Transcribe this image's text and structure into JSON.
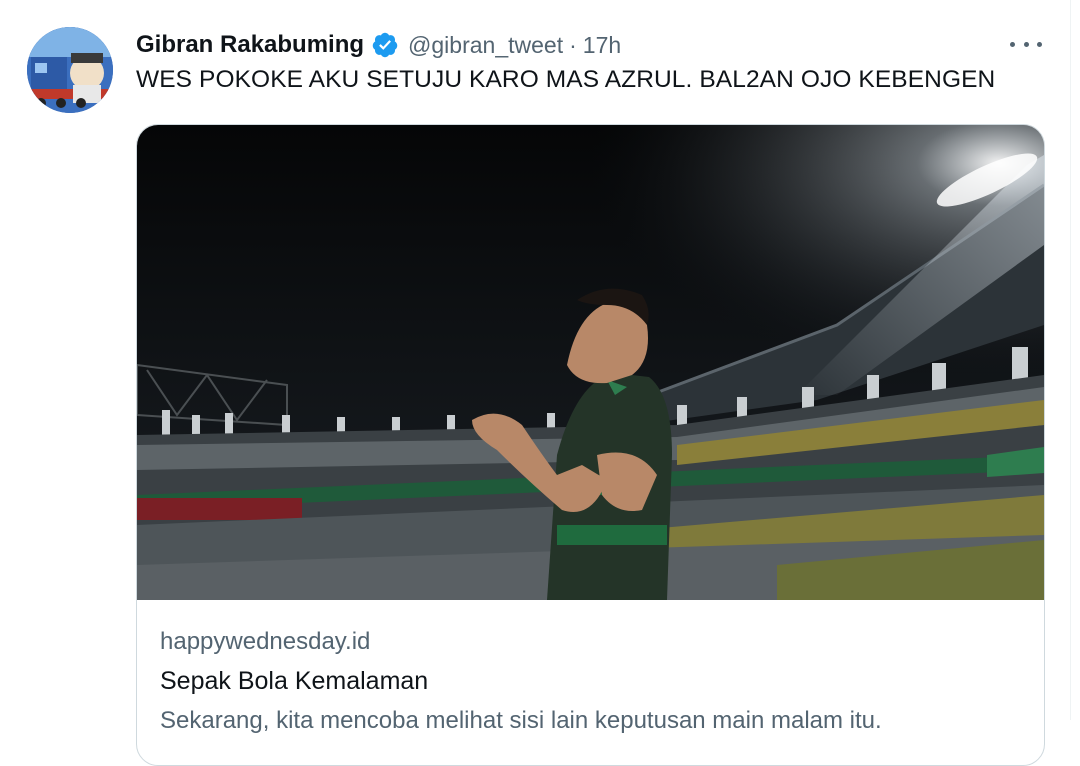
{
  "tweet": {
    "author_name": "Gibran Rakabuming",
    "handle": "@gibran_tweet",
    "separator": "·",
    "time": "17h",
    "text": "WES POKOKE AKU SETUJU KARO MAS AZRUL. BAL2AN OJO KEBENGEN"
  },
  "card": {
    "domain": "happywednesday.id",
    "title": "Sepak Bola Kemalaman",
    "description": "Sekarang, kita mencoba melihat sisi lain keputusan main malam itu."
  },
  "icons": {
    "verified": "verified-badge-icon",
    "more": "more-options-icon"
  },
  "colors": {
    "verified_blue": "#1d9bf0",
    "secondary_text": "#536471",
    "primary_text": "#0f1419",
    "card_border": "#cfd9de"
  }
}
